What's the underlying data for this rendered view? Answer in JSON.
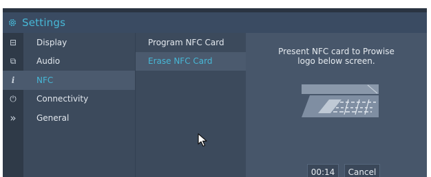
{
  "header": {
    "title": "Settings",
    "icon": "gear-icon"
  },
  "rail": [
    {
      "icon": "display-icon",
      "glyph": "⊟",
      "active": false
    },
    {
      "icon": "audio-icon",
      "glyph": "⧉",
      "active": false
    },
    {
      "icon": "info-icon",
      "glyph": "i",
      "active": true
    },
    {
      "icon": "power-icon",
      "glyph": "⏻",
      "active": false
    },
    {
      "icon": "chevrons-right-icon",
      "glyph": "»",
      "active": false
    }
  ],
  "menu": {
    "items": [
      {
        "label": "Display"
      },
      {
        "label": "Audio"
      },
      {
        "label": "NFC"
      },
      {
        "label": "Connectivity"
      },
      {
        "label": "General"
      }
    ],
    "active_index": 2
  },
  "submenu": {
    "items": [
      {
        "label": "Program NFC Card"
      },
      {
        "label": "Erase NFC Card"
      }
    ],
    "active_index": 1
  },
  "detail": {
    "message_line1": "Present NFC card to Prowise",
    "message_line2": "logo below screen.",
    "timer": "00:14",
    "cancel_label": "Cancel"
  },
  "colors": {
    "accent": "#47b8d7",
    "panel": "#3c4a5c",
    "detail_panel": "#47566a",
    "active_row": "#4b5a6e"
  }
}
